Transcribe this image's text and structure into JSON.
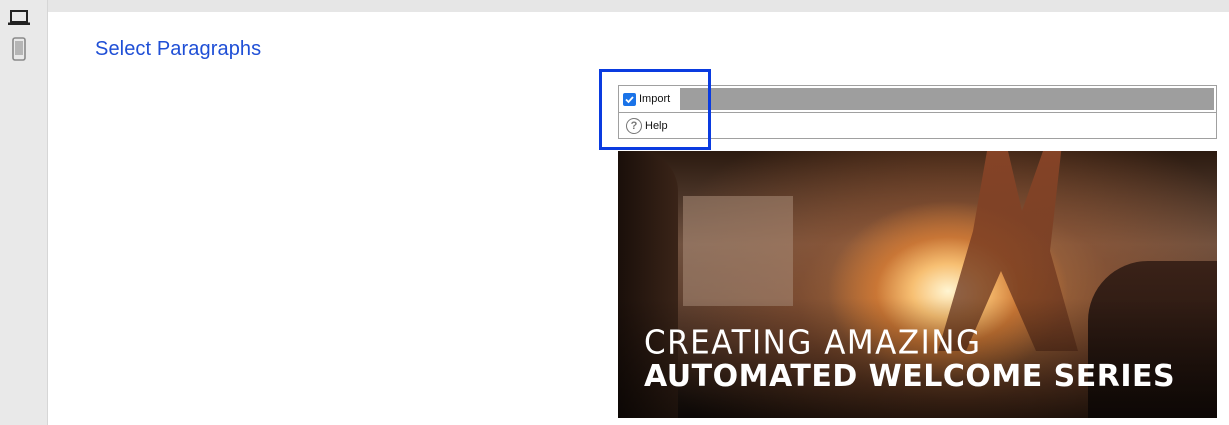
{
  "page": {
    "title": "Select Paragraphs"
  },
  "device_toggle": {
    "desktop_icon": "laptop-icon",
    "mobile_icon": "phone-icon"
  },
  "editor_toolbar": {
    "import_label": "Import",
    "import_checked": true,
    "help_label": "Help",
    "help_icon": "question-circle-icon"
  },
  "banner": {
    "line1": "CREATING AMAZING",
    "line2": "AUTOMATED WELCOME SERIES"
  },
  "colors": {
    "title_blue": "#1f4fd6",
    "highlight_blue": "#0a3be0",
    "checkbox_blue": "#1a73e8",
    "toolbar_gray": "#9e9e9e"
  }
}
